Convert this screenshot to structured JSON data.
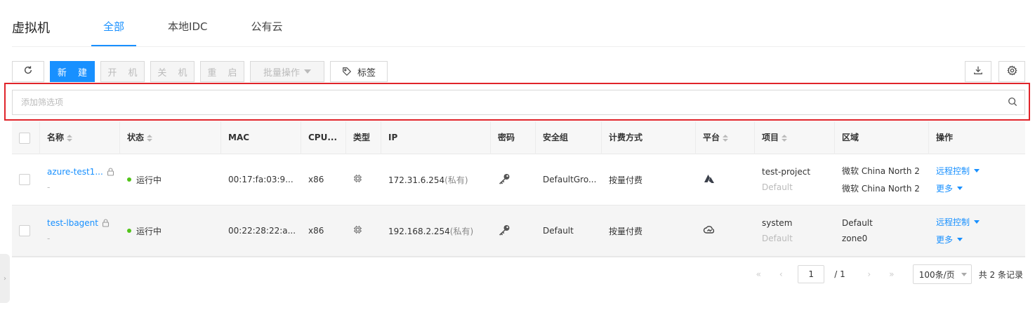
{
  "header": {
    "title": "虚拟机",
    "tabs": [
      {
        "label": "全部",
        "active": true
      },
      {
        "label": "本地IDC",
        "active": false
      },
      {
        "label": "公有云",
        "active": false
      }
    ]
  },
  "toolbar": {
    "refresh_icon": "refresh-icon",
    "new_label": "新 建",
    "start_label": "开 机",
    "stop_label": "关 机",
    "restart_label": "重 启",
    "batch_label": "批量操作",
    "tag_label": "标签",
    "tag_icon": "tag-icon",
    "download_icon": "download-icon",
    "settings_icon": "gear-icon"
  },
  "filter": {
    "placeholder": "添加筛选项",
    "icon": "search-icon"
  },
  "table": {
    "columns": {
      "name": "名称",
      "status": "状态",
      "mac": "MAC",
      "cpu": "CPU...",
      "type": "类型",
      "ip": "IP",
      "password": "密码",
      "secgroup": "安全组",
      "billing": "计费方式",
      "platform": "平台",
      "project": "项目",
      "region": "区域",
      "actions": "操作"
    },
    "rows": [
      {
        "name": "azure-test1...",
        "sub": "-",
        "status": "运行中",
        "mac": "00:17:fa:03:9...",
        "cpu": "x86",
        "ip": "172.31.6.254",
        "ip_note": "(私有)",
        "secgroup": "DefaultGro...",
        "billing": "按量付费",
        "platform_icon": "azure-icon",
        "project": "test-project",
        "project_domain": "Default",
        "region": "微软 China North 2",
        "zone": "微软 China North 2",
        "action1": "远程控制",
        "action2": "更多"
      },
      {
        "name": "test-lbagent",
        "sub": "-",
        "status": "运行中",
        "mac": "00:22:28:22:a...",
        "cpu": "x86",
        "ip": "192.168.2.254",
        "ip_note": "(私有)",
        "secgroup": "Default",
        "billing": "按量付费",
        "platform_icon": "onecloud-icon",
        "project": "system",
        "project_domain": "Default",
        "region": "Default",
        "zone": "zone0",
        "action1": "远程控制",
        "action2": "更多"
      }
    ]
  },
  "pagination": {
    "current_page": "1",
    "total_pages": "/ 1",
    "page_size": "100条/页",
    "record_count": "共 2 条记录"
  },
  "colors": {
    "accent": "#1890ff",
    "running": "#52c41a",
    "highlight": "#e0242a"
  }
}
